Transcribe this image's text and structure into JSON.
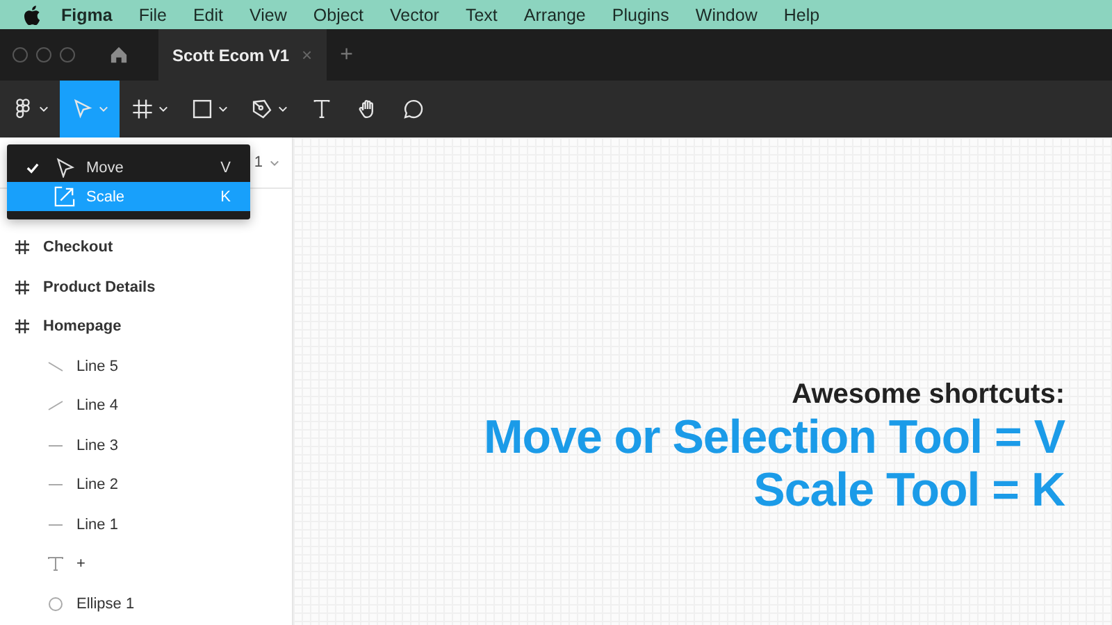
{
  "menu_bar": {
    "app": "Figma",
    "items": [
      "File",
      "Edit",
      "View",
      "Object",
      "Vector",
      "Text",
      "Arrange",
      "Plugins",
      "Window",
      "Help"
    ]
  },
  "tabs": [
    {
      "label": "Scott Ecom V1",
      "selected": true,
      "close": "×"
    }
  ],
  "new_tab": "+",
  "toolbar": [
    {
      "kind": "figma",
      "selected": false,
      "caret": true
    },
    {
      "kind": "move",
      "selected": true,
      "caret": true
    },
    {
      "kind": "frame",
      "selected": false,
      "caret": true
    },
    {
      "kind": "rect",
      "selected": false,
      "caret": true
    },
    {
      "kind": "pen",
      "selected": false,
      "caret": true
    },
    {
      "kind": "text",
      "selected": false,
      "caret": false
    },
    {
      "kind": "hand",
      "selected": false,
      "caret": false
    },
    {
      "kind": "comment",
      "selected": false,
      "caret": false
    }
  ],
  "page_header": {
    "label": "1"
  },
  "dropdown": [
    {
      "kind": "move",
      "label": "Move",
      "shortcut": "V",
      "checked": true,
      "selected": false
    },
    {
      "kind": "scale",
      "label": "Scale",
      "shortcut": "K",
      "checked": false,
      "selected": true
    }
  ],
  "layers": [
    {
      "kind": "frame",
      "name": "Checkout"
    },
    {
      "kind": "frame",
      "name": "Product Details"
    },
    {
      "kind": "frame",
      "name": "Homepage",
      "children": [
        {
          "kind": "line-down",
          "name": "Line 5"
        },
        {
          "kind": "line-up",
          "name": "Line 4"
        },
        {
          "kind": "line",
          "name": "Line 3"
        },
        {
          "kind": "line",
          "name": "Line 2"
        },
        {
          "kind": "line",
          "name": "Line 1"
        },
        {
          "kind": "text",
          "name": "+"
        },
        {
          "kind": "ellipse",
          "name": "Ellipse 1"
        }
      ]
    }
  ],
  "caption": {
    "heading": "Awesome shortcuts:",
    "lines": [
      "Move or Selection Tool = V",
      "Scale Tool = K"
    ]
  }
}
